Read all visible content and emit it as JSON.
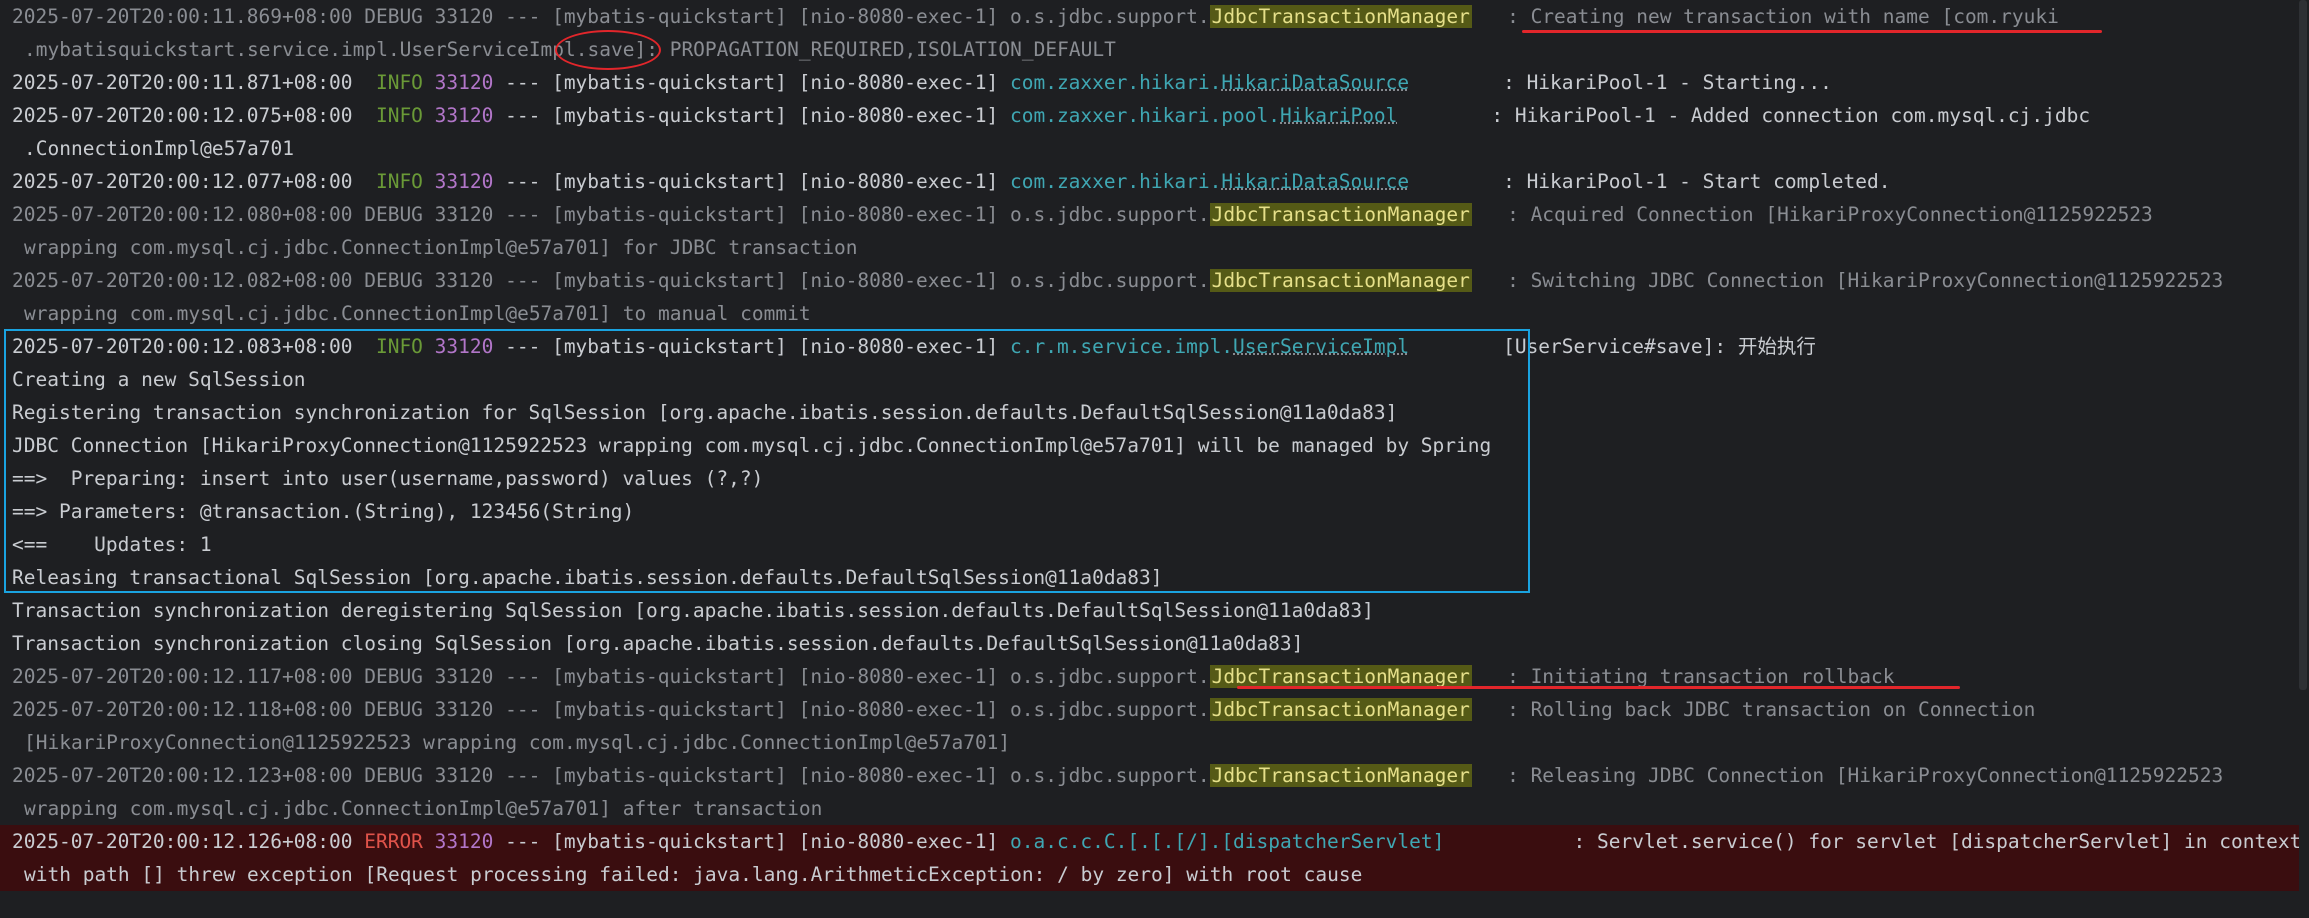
{
  "console": {
    "lines": [
      {
        "ts": "2025-07-20T20:00:11.869+08:00",
        "level": "DEBUG",
        "pid": "33120",
        "app": "[mybatis-quickstart]",
        "thread": "[nio-8080-exec-1]",
        "logger_prefix": "o.s.jdbc.support.",
        "logger_class": "JdbcTransactionManager",
        "message": " : Creating new transaction with name [com.ryuki"
      },
      {
        "cont": ".mybatisquickstart.service.impl.UserServiceImpl.save]: PROPAGATION_REQUIRED,ISOLATION_DEFAULT"
      },
      {
        "ts": "2025-07-20T20:00:11.871+08:00",
        "level": " INFO",
        "pid": "33120",
        "app": "[mybatis-quickstart]",
        "thread": "[nio-8080-exec-1]",
        "logger_prefix": "com.zaxxer.hikari.",
        "logger_class": "HikariDataSource",
        "message": " : HikariPool-1 - Starting..."
      },
      {
        "ts": "2025-07-20T20:00:12.075+08:00",
        "level": " INFO",
        "pid": "33120",
        "app": "[mybatis-quickstart]",
        "thread": "[nio-8080-exec-1]",
        "logger_prefix": "com.zaxxer.hikari.pool.",
        "logger_class": "HikariPool",
        "message": " : HikariPool-1 - Added connection com.mysql.cj.jdbc"
      },
      {
        "cont": ".ConnectionImpl@e57a701"
      },
      {
        "ts": "2025-07-20T20:00:12.077+08:00",
        "level": " INFO",
        "pid": "33120",
        "app": "[mybatis-quickstart]",
        "thread": "[nio-8080-exec-1]",
        "logger_prefix": "com.zaxxer.hikari.",
        "logger_class": "HikariDataSource",
        "message": " : HikariPool-1 - Start completed."
      },
      {
        "ts": "2025-07-20T20:00:12.080+08:00",
        "level": "DEBUG",
        "pid": "33120",
        "app": "[mybatis-quickstart]",
        "thread": "[nio-8080-exec-1]",
        "logger_prefix": "o.s.jdbc.support.",
        "logger_class": "JdbcTransactionManager",
        "message": " : Acquired Connection [HikariProxyConnection@1125922523"
      },
      {
        "cont": "wrapping com.mysql.cj.jdbc.ConnectionImpl@e57a701] for JDBC transaction"
      },
      {
        "ts": "2025-07-20T20:00:12.082+08:00",
        "level": "DEBUG",
        "pid": "33120",
        "app": "[mybatis-quickstart]",
        "thread": "[nio-8080-exec-1]",
        "logger_prefix": "o.s.jdbc.support.",
        "logger_class": "JdbcTransactionManager",
        "message": " : Switching JDBC Connection [HikariProxyConnection@1125922523"
      },
      {
        "cont": "wrapping com.mysql.cj.jdbc.ConnectionImpl@e57a701] to manual commit"
      },
      {
        "ts": "2025-07-20T20:00:12.083+08:00",
        "level": " INFO",
        "pid": "33120",
        "app": "[mybatis-quickstart]",
        "thread": "[nio-8080-exec-1]",
        "logger_prefix": "c.r.m.service.impl.",
        "logger_class": "UserServiceImpl",
        "message": " [UserService#save]: 开始执行"
      },
      {
        "plain": "Creating a new SqlSession"
      },
      {
        "plain": "Registering transaction synchronization for SqlSession [org.apache.ibatis.session.defaults.DefaultSqlSession@11a0da83]"
      },
      {
        "plain": "JDBC Connection [HikariProxyConnection@1125922523 wrapping com.mysql.cj.jdbc.ConnectionImpl@e57a701] will be managed by Spring"
      },
      {
        "plain": "==>  Preparing: insert into user(username,password) values (?,?)"
      },
      {
        "plain": "==> Parameters: @transaction.(String), 123456(String)"
      },
      {
        "plain": "<==    Updates: 1"
      },
      {
        "plain": "Releasing transactional SqlSession [org.apache.ibatis.session.defaults.DefaultSqlSession@11a0da83]"
      },
      {
        "plain": "Transaction synchronization deregistering SqlSession [org.apache.ibatis.session.defaults.DefaultSqlSession@11a0da83]"
      },
      {
        "plain": "Transaction synchronization closing SqlSession [org.apache.ibatis.session.defaults.DefaultSqlSession@11a0da83]"
      },
      {
        "ts": "2025-07-20T20:00:12.117+08:00",
        "level": "DEBUG",
        "pid": "33120",
        "app": "[mybatis-quickstart]",
        "thread": "[nio-8080-exec-1]",
        "logger_prefix": "o.s.jdbc.support.",
        "logger_class": "JdbcTransactionManager",
        "message": " : Initiating transaction rollback"
      },
      {
        "ts": "2025-07-20T20:00:12.118+08:00",
        "level": "DEBUG",
        "pid": "33120",
        "app": "[mybatis-quickstart]",
        "thread": "[nio-8080-exec-1]",
        "logger_prefix": "o.s.jdbc.support.",
        "logger_class": "JdbcTransactionManager",
        "message": " : Rolling back JDBC transaction on Connection"
      },
      {
        "cont": "[HikariProxyConnection@1125922523 wrapping com.mysql.cj.jdbc.ConnectionImpl@e57a701]"
      },
      {
        "ts": "2025-07-20T20:00:12.123+08:00",
        "level": "DEBUG",
        "pid": "33120",
        "app": "[mybatis-quickstart]",
        "thread": "[nio-8080-exec-1]",
        "logger_prefix": "o.s.jdbc.support.",
        "logger_class": "JdbcTransactionManager",
        "message": " : Releasing JDBC Connection [HikariProxyConnection@1125922523"
      },
      {
        "cont": "wrapping com.mysql.cj.jdbc.ConnectionImpl@e57a701] after transaction"
      },
      {
        "ts": "2025-07-20T20:00:12.126+08:00",
        "level": "ERROR",
        "pid": "33120",
        "app": "[mybatis-quickstart]",
        "thread": "[nio-8080-exec-1]",
        "logger_prefix": "o.a.c.c.C.[.[.[/].",
        "logger_class": "[dispatcherServlet]",
        "message": "    : Servlet.service() for servlet [dispatcherServlet] in context"
      },
      {
        "cont": "with path [] threw exception [Request processing failed: java.lang.ArithmeticException: / by zero] with root cause",
        "error_cont": true
      }
    ]
  },
  "colors": {
    "background": "#1e1f22",
    "debug_text": "#8a8d93",
    "info_level": "#6a9a37",
    "error_level": "#e0534a",
    "pid": "#b276c9",
    "logger": "#3fa7b3",
    "highlight_bg": "#555a16",
    "annotation_box": "#1aa3e0",
    "annotation_red": "#e2262b",
    "error_band": "#3a0d0f"
  }
}
